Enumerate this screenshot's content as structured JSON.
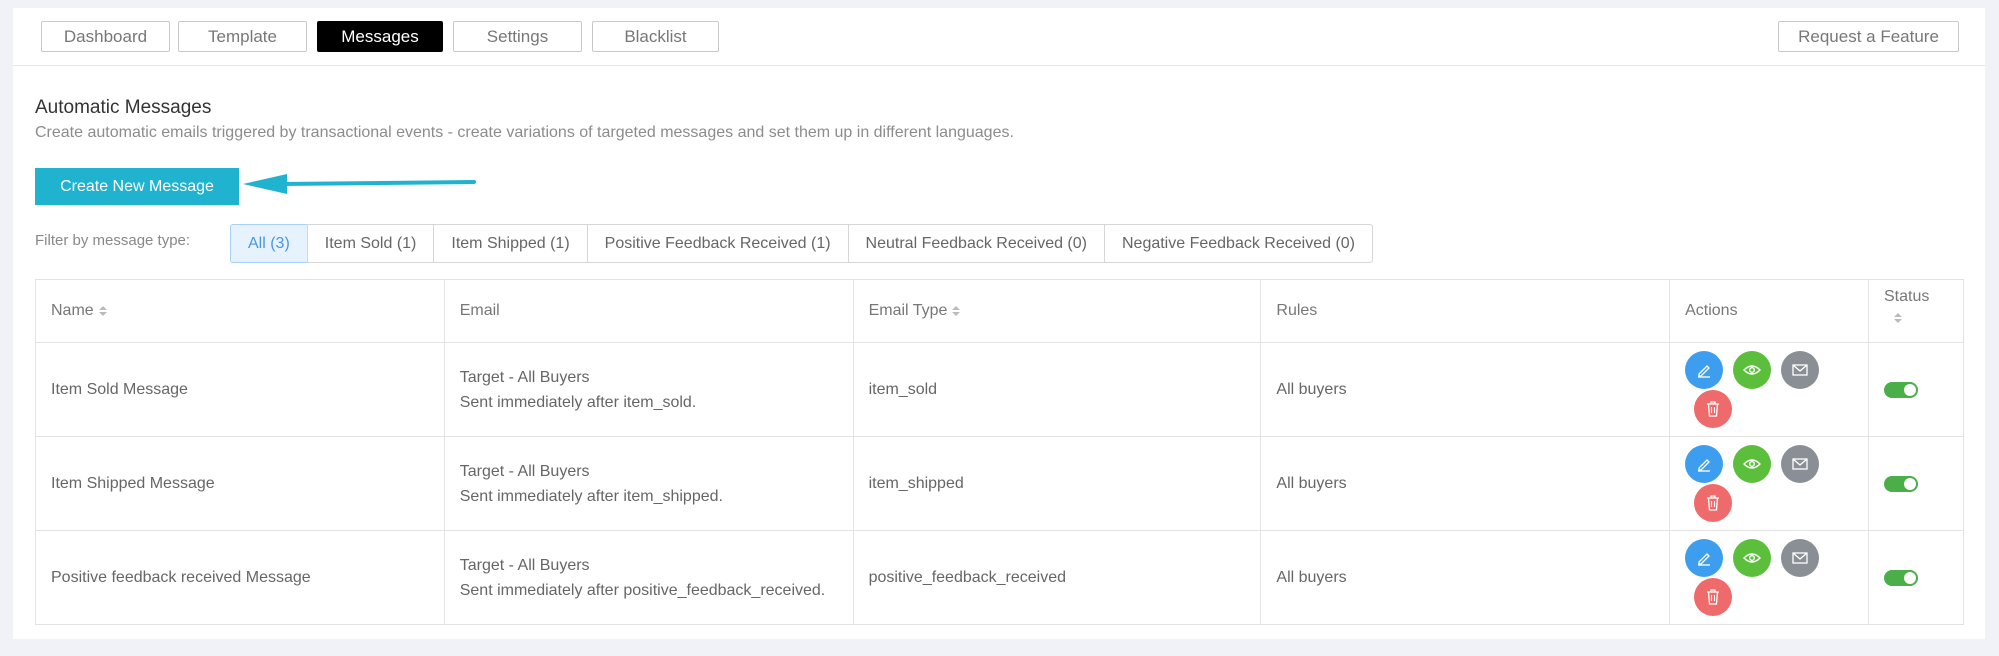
{
  "nav": {
    "tabs": [
      "Dashboard",
      "Template",
      "Messages",
      "Settings",
      "Blacklist"
    ],
    "active_tab": "Messages",
    "request_feature": "Request a Feature"
  },
  "header": {
    "title": "Automatic Messages",
    "subtitle": "Create automatic emails triggered by transactional events - create variations of targeted messages and set them up in different languages."
  },
  "create_button": "Create New Message",
  "filter": {
    "label": "Filter by message type:",
    "options": [
      "All (3)",
      "Item Sold (1)",
      "Item Shipped (1)",
      "Positive Feedback Received (1)",
      "Neutral Feedback Received (0)",
      "Negative Feedback Received (0)"
    ],
    "active": "All (3)"
  },
  "table": {
    "columns": {
      "name": "Name",
      "email": "Email",
      "email_type": "Email Type",
      "rules": "Rules",
      "actions": "Actions",
      "status": "Status"
    },
    "rows": [
      {
        "name": "Item Sold Message",
        "email_target": "Target - All Buyers",
        "email_desc": "Sent immediately after item_sold.",
        "email_type": "item_sold",
        "rules": "All buyers",
        "status": "on"
      },
      {
        "name": "Item Shipped Message",
        "email_target": "Target - All Buyers",
        "email_desc": "Sent immediately after item_shipped.",
        "email_type": "item_shipped",
        "rules": "All buyers",
        "status": "on"
      },
      {
        "name": "Positive feedback received Message",
        "email_target": "Target - All Buyers",
        "email_desc": "Sent immediately after positive_feedback_received.",
        "email_type": "positive_feedback_received",
        "rules": "All buyers",
        "status": "on"
      }
    ]
  },
  "colors": {
    "accent": "#1fb3d0",
    "edit": "#3d9ef0",
    "view": "#5cbf3c",
    "mail": "#8a8e95",
    "delete": "#ef6a6a",
    "toggle_on": "#4aae49"
  },
  "icons": [
    "pencil-icon",
    "eye-icon",
    "envelope-icon",
    "trash-icon",
    "arrow-icon"
  ]
}
